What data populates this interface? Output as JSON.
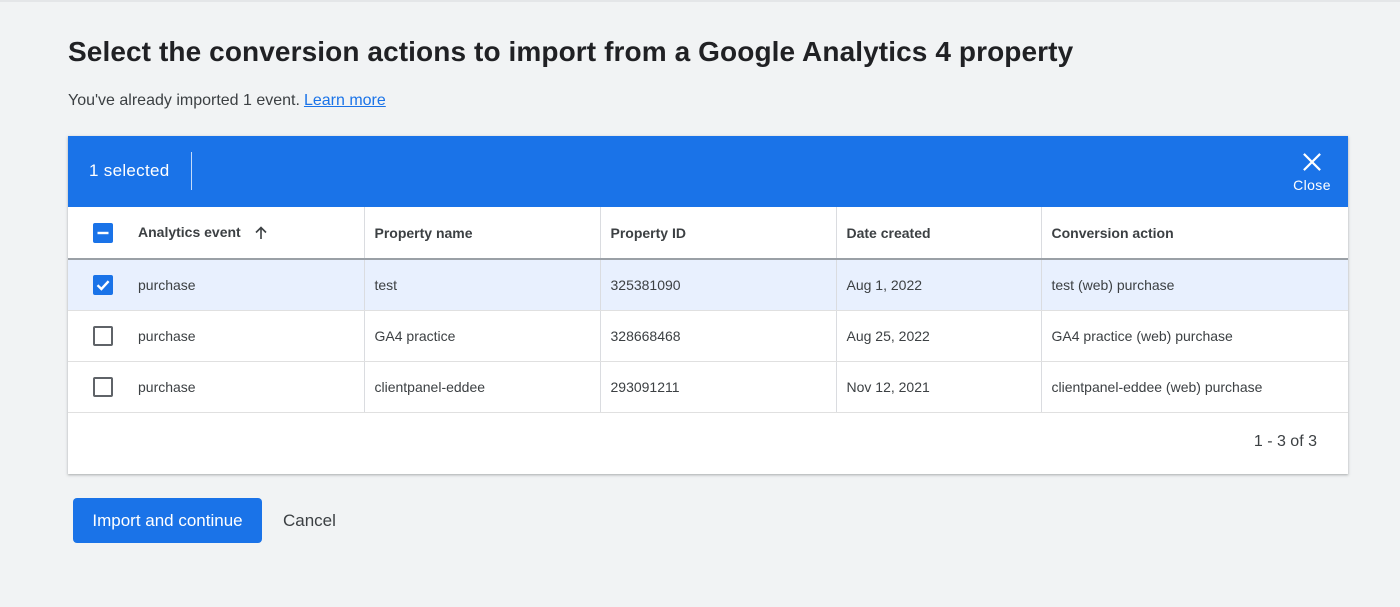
{
  "page": {
    "title": "Select the conversion actions to import from a Google Analytics 4 property",
    "intro_text": "You've already imported 1 event.",
    "learn_more": "Learn more"
  },
  "selection_bar": {
    "count_label": "1 selected",
    "close_label": "Close",
    "close_icon": "close-icon"
  },
  "table": {
    "columns": [
      "Analytics event",
      "Property name",
      "Property ID",
      "Date created",
      "Conversion action"
    ],
    "sorted_column": "Analytics event",
    "sort_direction": "ascending",
    "header_checkbox_state": "indeterminate",
    "rows": [
      {
        "selected": true,
        "event": "purchase",
        "property_name": "test",
        "property_id": "325381090",
        "date_created": "Aug 1, 2022",
        "conversion_action": "test (web) purchase"
      },
      {
        "selected": false,
        "event": "purchase",
        "property_name": "GA4 practice",
        "property_id": "328668468",
        "date_created": "Aug 25, 2022",
        "conversion_action": "GA4 practice (web) purchase"
      },
      {
        "selected": false,
        "event": "purchase",
        "property_name": "clientpanel-eddee",
        "property_id": "293091211",
        "date_created": "Nov 12, 2021",
        "conversion_action": "clientpanel-eddee (web) purchase"
      }
    ],
    "pagination": "1 - 3 of 3"
  },
  "actions": {
    "primary": "Import and continue",
    "secondary": "Cancel"
  },
  "colors": {
    "accent": "#1a73e8",
    "selected_row": "#e8f0fe",
    "background": "#f1f3f4"
  }
}
